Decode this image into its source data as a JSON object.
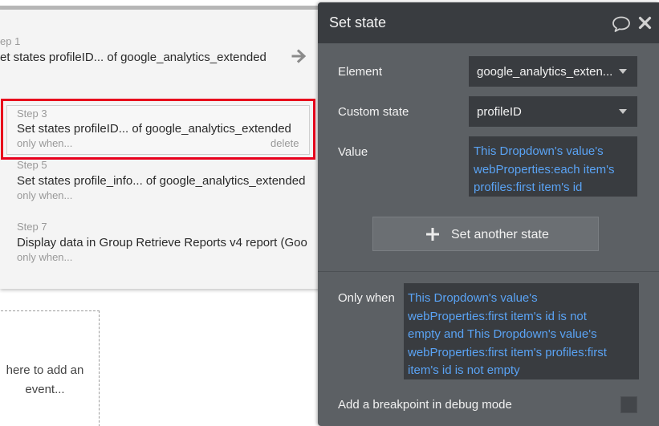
{
  "steps": [
    {
      "number": "ep 1",
      "title": "et states profileID... of google_analytics_extended"
    },
    {
      "number": "Step 3",
      "title": "Set states profileID... of google_analytics_extended",
      "only_when": "only when...",
      "delete": "delete"
    },
    {
      "number": "Step 5",
      "title": "Set states profile_info... of google_analytics_extended",
      "only_when": "only when..."
    },
    {
      "number": "Step 7",
      "title": "Display data in Group Retrieve Reports v4 report (Goo",
      "only_when": "only when..."
    }
  ],
  "add_event": {
    "line1": "here to add an",
    "line2": "event..."
  },
  "editor": {
    "title": "Set state",
    "element": {
      "label": "Element",
      "value": "google_analytics_exten..."
    },
    "custom_state": {
      "label": "Custom state",
      "value": "profileID"
    },
    "value_field": {
      "label": "Value",
      "lines": [
        "This Dropdown's value's",
        "webProperties:each item's",
        "profiles:first item's id"
      ]
    },
    "set_another_label": "Set another state",
    "only_when": {
      "label": "Only when",
      "lines": [
        "This Dropdown's value's",
        "webProperties:first item's id is not",
        "empty and This Dropdown's value's",
        "webProperties:first item's profiles:first",
        "item's id is not empty"
      ]
    },
    "breakpoint_label": "Add a breakpoint in debug mode"
  },
  "colors": {
    "selection_outline": "#e8001c",
    "expression_text": "#5aa3f4",
    "editor_bg": "#5c6064",
    "header_bg": "#393c40"
  },
  "icons": [
    "arrow-right-icon",
    "comment-icon",
    "close-icon",
    "plus-icon",
    "caret-down-icon"
  ]
}
